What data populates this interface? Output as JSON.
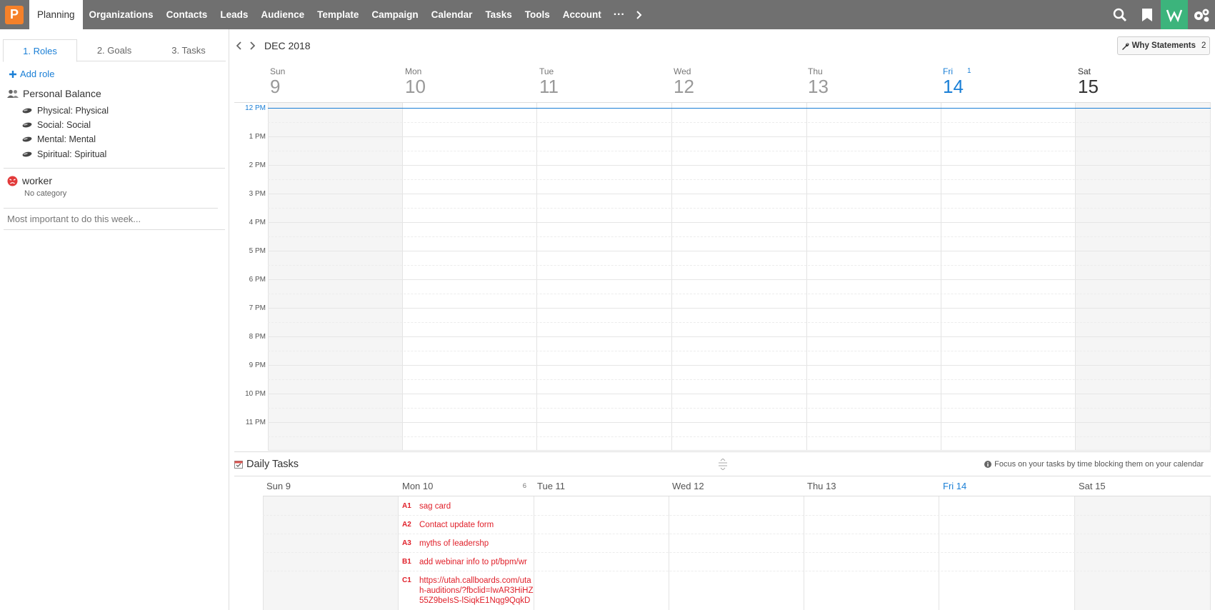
{
  "nav": {
    "logo": "P",
    "items": [
      "Planning",
      "Organizations",
      "Contacts",
      "Leads",
      "Audience",
      "Template",
      "Campaign",
      "Calendar",
      "Tasks",
      "Tools",
      "Account"
    ],
    "more": "···"
  },
  "left": {
    "tabs": [
      "1. Roles",
      "2. Goals",
      "3. Tasks"
    ],
    "add_role": "Add role",
    "group": "Personal Balance",
    "roles": [
      "Physical: Physical",
      "Social: Social",
      "Mental: Mental",
      "Spiritual: Spiritual"
    ],
    "worker": "worker",
    "worker_sub": "No category",
    "most_important_placeholder": "Most important to do this week..."
  },
  "calendar": {
    "month": "DEC 2018",
    "why_label": "Why Statements",
    "why_count": "2",
    "days": [
      {
        "name": "Sun",
        "num": "9"
      },
      {
        "name": "Mon",
        "num": "10"
      },
      {
        "name": "Tue",
        "num": "11"
      },
      {
        "name": "Wed",
        "num": "12"
      },
      {
        "name": "Thu",
        "num": "13"
      },
      {
        "name": "Fri",
        "num": "14",
        "badge": "1"
      },
      {
        "name": "Sat",
        "num": "15"
      }
    ],
    "hours": [
      "12 PM",
      "1 PM",
      "2 PM",
      "3 PM",
      "4 PM",
      "5 PM",
      "6 PM",
      "7 PM",
      "8 PM",
      "9 PM",
      "10 PM",
      "11 PM"
    ]
  },
  "daily": {
    "title": "Daily Tasks",
    "hint": "Focus on your tasks by time blocking them on your calendar",
    "day_labels": [
      "Sun 9",
      "Mon 10",
      "Tue 11",
      "Wed 12",
      "Thu 13",
      "Fri 14",
      "Sat 15"
    ],
    "mon_count": "6",
    "tasks": [
      {
        "pri": "A1",
        "text": "sag card"
      },
      {
        "pri": "A2",
        "text": "Contact update form"
      },
      {
        "pri": "A3",
        "text": "myths of leadershp"
      },
      {
        "pri": "B1",
        "text": "add webinar info to pt/bpm/wr"
      },
      {
        "pri": "C1",
        "text": "https://utah.callboards.com/utah-auditions/?fbclid=IwAR3HiHZ55Z9beIsS-lSiqkE1Nqg9QqkD"
      }
    ]
  },
  "colors": {
    "nav_bg": "#707070",
    "accent": "#1a7fd6",
    "task_red": "#e0202a",
    "logo": "#f5812a",
    "w_icon_bg": "#3cb47c"
  }
}
